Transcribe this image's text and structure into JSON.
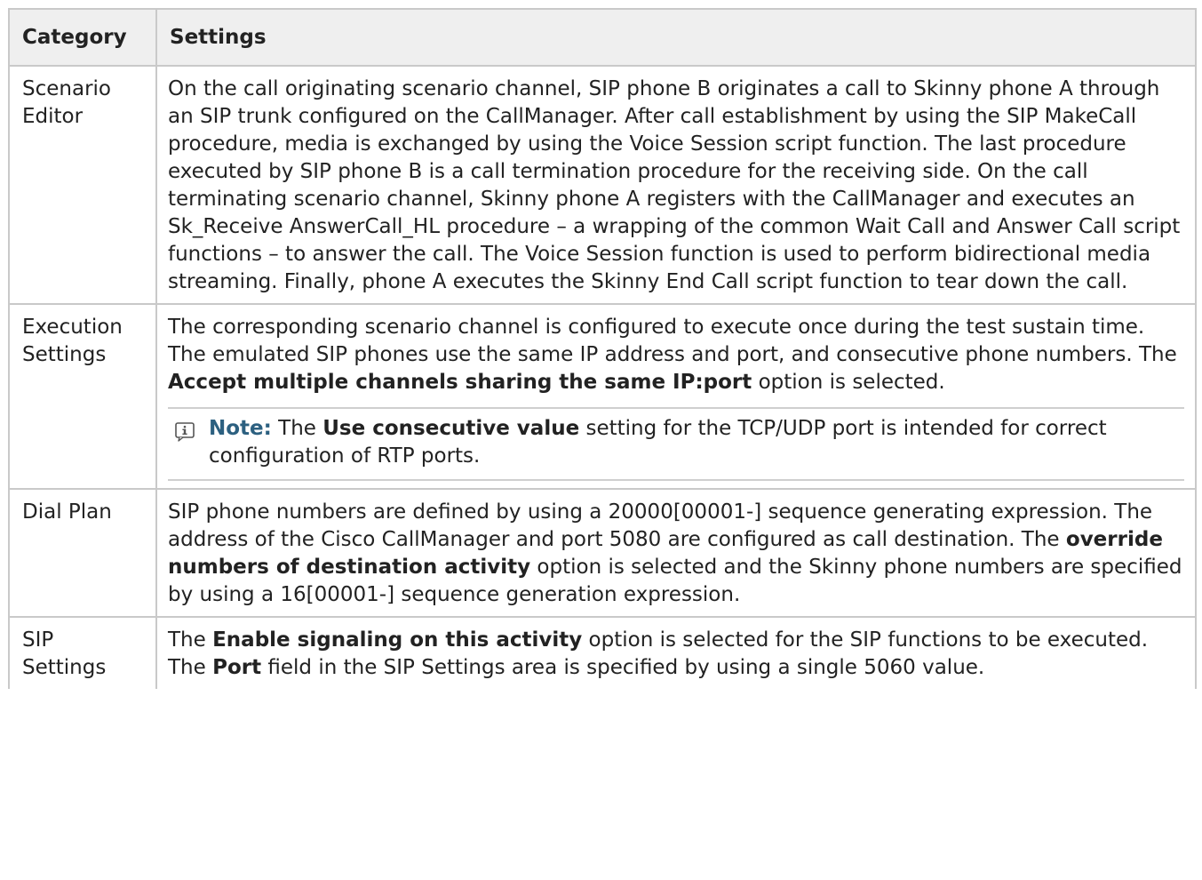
{
  "table": {
    "header": {
      "category": "Category",
      "settings": "Settings"
    },
    "rows": [
      {
        "category": [
          "Scenario",
          "Editor"
        ],
        "settings": {
          "text": "On the call originating scenario channel, SIP phone B originates a call to Skinny phone A through an SIP trunk configured on the CallManager. After call establishment by using the SIP MakeCall procedure, media is exchanged by using the Voice Session script function. The last procedure executed by SIP phone B is a call termination procedure for the receiving side. On the call terminating scenario channel, Skinny phone A registers with the CallManager and executes an Sk_Receive AnswerCall_HL procedure – a wrapping of the common Wait Call and Answer Call script functions – to answer the call. The Voice Session function is used to perform bidirectional media streaming. Finally, phone A executes the Skinny End Call script function to tear down the call."
        }
      },
      {
        "category": [
          "Execution",
          "Settings"
        ],
        "settings": {
          "text_1": "The corresponding scenario channel is configured to execute once during the test sustain time. The emulated SIP phones use the same IP address and port, and consecutive phone numbers. The ",
          "bold_1": "Accept multiple channels sharing the same IP:port",
          "text_2": " option is selected.",
          "note": {
            "icon": "info-icon",
            "label": "Note:",
            "text_1": " The ",
            "bold_1": "Use consecutive value",
            "text_2": " setting for the TCP/UDP port is intended for correct configuration of RTP ports."
          }
        }
      },
      {
        "category": [
          "Dial Plan"
        ],
        "settings": {
          "text_1": "SIP phone numbers are defined by using a 20000[00001-] sequence generating expression. The address of the Cisco CallManager and port 5080 are configured as call destination. The ",
          "bold_1": "override numbers of destination activity",
          "text_2": " option is selected and the Skinny phone numbers are specified by using a 16[00001-] sequence generation expression."
        }
      },
      {
        "category": [
          "SIP",
          "Settings"
        ],
        "settings": {
          "text_1": "The ",
          "bold_1": "Enable signaling on this activity",
          "text_2": " option is selected for the SIP functions to be executed. The ",
          "bold_2": "Port",
          "text_3": " field in the SIP Settings area is specified by using a single 5060 value."
        }
      }
    ]
  },
  "colors": {
    "header_bg": "#efefef",
    "border": "#c9c9c9",
    "note_label": "#2c6080",
    "text": "#222222"
  }
}
